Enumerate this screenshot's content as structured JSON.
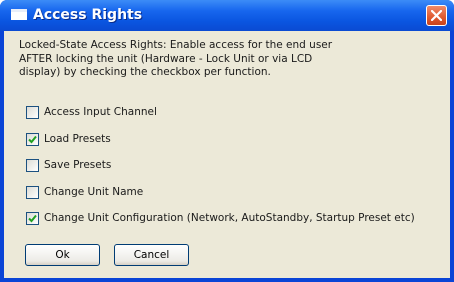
{
  "window": {
    "title": "Access Rights"
  },
  "icons": {
    "window_icon": "window-icon",
    "close": "close-icon",
    "check": "checkmark-icon"
  },
  "colors": {
    "titlebar": "#0a55e0",
    "close_button": "#e05a2f",
    "client": "#ece9d8",
    "check": "#21a121"
  },
  "description": "Locked-State Access Rights: Enable access for the end user\nAFTER locking the unit (Hardware - Lock Unit or via LCD\ndisplay) by checking the checkbox per function.",
  "options": [
    {
      "label": "Access Input Channel",
      "checked": false
    },
    {
      "label": "Load Presets",
      "checked": true
    },
    {
      "label": "Save Presets",
      "checked": false
    },
    {
      "label": "Change Unit Name",
      "checked": false
    },
    {
      "label": "Change Unit Configuration (Network, AutoStandby, Startup Preset etc)",
      "checked": true
    }
  ],
  "buttons": {
    "ok": "Ok",
    "cancel": "Cancel"
  }
}
